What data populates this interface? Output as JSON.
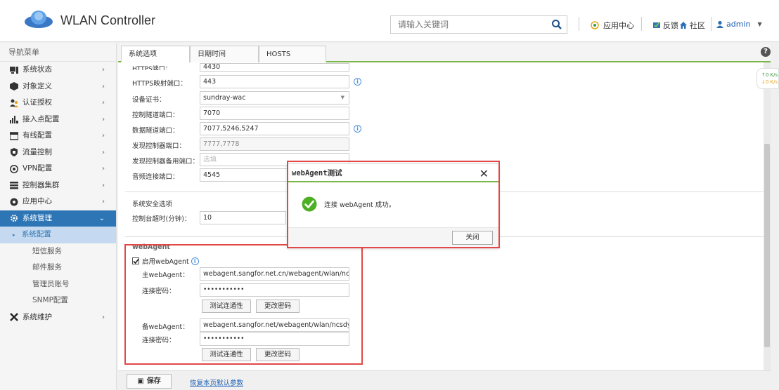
{
  "header": {
    "title": "WLAN Controller",
    "search_placeholder": "请输入关键词",
    "app_center": "应用中心",
    "feedback": "反馈",
    "community": "社区",
    "user": "admin"
  },
  "sidebar": {
    "title": "导航菜单",
    "items": [
      {
        "label": "系统状态"
      },
      {
        "label": "对象定义"
      },
      {
        "label": "认证授权"
      },
      {
        "label": "接入点配置"
      },
      {
        "label": "有线配置"
      },
      {
        "label": "流量控制"
      },
      {
        "label": "VPN配置"
      },
      {
        "label": "控制器集群"
      },
      {
        "label": "应用中心"
      },
      {
        "label": "系统管理"
      }
    ],
    "subitems": [
      "系统配置",
      "短信服务",
      "邮件服务",
      "管理员账号",
      "SNMP配置"
    ],
    "last_item": "系统维护"
  },
  "tabs": [
    "系统选项",
    "日期时间",
    "HOSTS"
  ],
  "form": {
    "https_port_label": "HTTPS端口：",
    "https_port": "4430",
    "https_map_label": "HTTPS映射端口：",
    "https_map": "443",
    "cert_label": "设备证书：",
    "cert": "sundray-wac",
    "ctrl_tunnel_label": "控制隧道端口：",
    "ctrl_tunnel": "7070",
    "data_tunnel_label": "数据隧道端口：",
    "data_tunnel": "7077,5246,5247",
    "discover_label": "发现控制器端口：",
    "discover": "7777,7778",
    "discover_backup_label": "发现控制器备用端口：",
    "discover_backup_ph": "选填",
    "audio_label": "音频连接端口：",
    "audio": "4545",
    "security_title": "系统安全选项",
    "timeout_label": "控制台超时(分钟)：",
    "timeout": "10"
  },
  "webagent": {
    "title": "webAgent",
    "enable_label": "启用webAgent",
    "main_label": "主webAgent：",
    "main_url": "webagent.sangfor.net.cn/webagent/wlan/ncsdyyy/r",
    "pwd_label": "连接密码：",
    "pwd": "•••••••••••",
    "test_btn": "测试连通性",
    "change_btn": "更改密码",
    "backup_label": "备webAgent：",
    "backup_url": "webagent.sangfor.net/webagent/wlan/ncsdyyy/ncsı",
    "pwd2": "•••••••••••"
  },
  "bottom": {
    "save": "保存",
    "restore": "恢复本页默认参数"
  },
  "dialog": {
    "title": "webAgent测试",
    "message": "连接 webAgent 成功。",
    "close_btn": "关闭"
  },
  "widget": {
    "up": "↑0 K/s",
    "down": "↓0 K/s"
  },
  "colors": {
    "accent": "#2e75b5",
    "green_bar": "#7ab648",
    "highlight_red": "#e24848"
  }
}
